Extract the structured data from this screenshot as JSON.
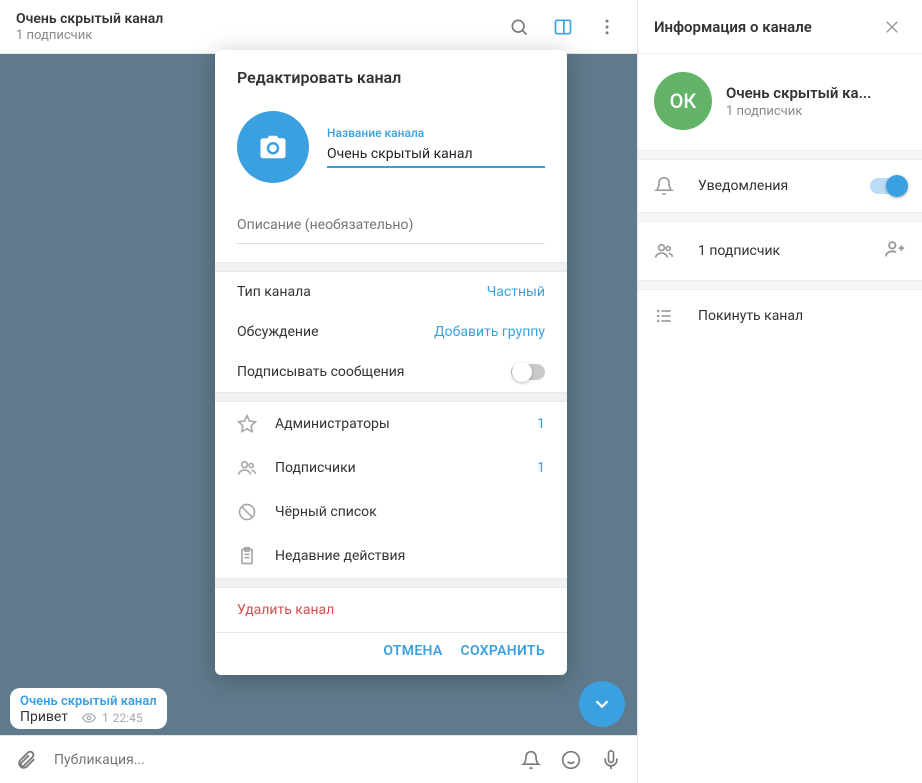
{
  "header": {
    "title": "Очень скрытый канал",
    "subtitle": "1 подписчик"
  },
  "message": {
    "channel_name": "Очень скрытый канал",
    "text": "Привет",
    "views": "1",
    "time": "22:45"
  },
  "composer": {
    "placeholder": "Публикация..."
  },
  "modal": {
    "title": "Редактировать канал",
    "name_label": "Название канала",
    "name_value": "Очень скрытый канал",
    "desc_placeholder": "Описание (необязательно)",
    "type_label": "Тип канала",
    "type_value": "Частный",
    "discussion_label": "Обсуждение",
    "discussion_value": "Добавить группу",
    "sign_label": "Подписывать сообщения",
    "admins_label": "Администраторы",
    "admins_count": "1",
    "subs_label": "Подписчики",
    "subs_count": "1",
    "blacklist_label": "Чёрный список",
    "recent_label": "Недавние действия",
    "delete_label": "Удалить канал",
    "cancel": "ОТМЕНА",
    "save": "СОХРАНИТЬ"
  },
  "right_panel": {
    "title": "Информация о канале",
    "avatar_initials": "ОК",
    "name": "Очень скрытый ка...",
    "subtitle": "1 подписчик",
    "notifications_label": "Уведомления",
    "subscribers_label": "1 подписчик",
    "leave_label": "Покинуть канал"
  }
}
